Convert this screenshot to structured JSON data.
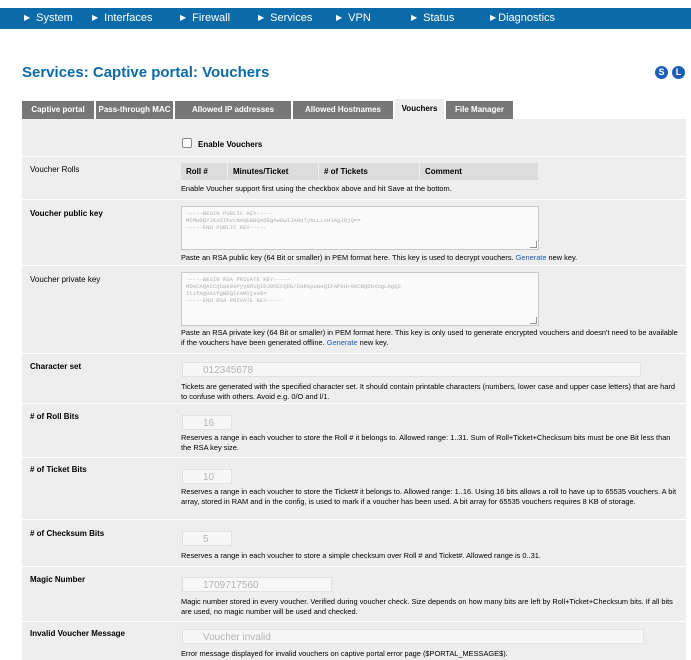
{
  "nav": {
    "items": [
      "System",
      "Interfaces",
      "Firewall",
      "Services",
      "VPN",
      "Status",
      "Diagnostics"
    ]
  },
  "page": {
    "title": "Services: Captive portal: Vouchers",
    "icon_s": "S",
    "icon_l": "L"
  },
  "tabs": [
    "Captive portal",
    "Pass-through MAC",
    "Allowed IP addresses",
    "Allowed Hostnames",
    "Vouchers",
    "File Manager"
  ],
  "active_tab": "Vouchers",
  "enable": {
    "label": "Enable Vouchers",
    "checked": false
  },
  "rolls": {
    "label": "Voucher Rolls",
    "columns": [
      "Roll #",
      "Minutes/Ticket",
      "# of Tickets",
      "Comment"
    ],
    "note": "Enable Voucher support first using the checkbox above and hit Save at the bottom."
  },
  "public_key": {
    "label": "Voucher public key",
    "value": "-----BEGIN PUBLIC KEY-----\nMCMwDQYJKoZIhvcNAQEBBQADEgAwDwIJANqTybLLLxH1AgJ8jQ==\n-----END PUBLIC KEY-----",
    "desc_before": "Paste an RSA public key (64 Bit or smaller) in PEM format here. This key is used to decrypt vouchers.",
    "link": "Generate",
    "desc_after": "new key."
  },
  "private_key": {
    "label": "Voucher private key",
    "value": "-----BEGIN RSA PRIVATE KEY-----\nMDsCAQACCQDak8sPyy8RSQIDJ0OCCQDG/DaRspuGeQIFAP8U+00CBQDbXUgLAgQ2\nItzfAgUAifgWEQIFAM3jse8=\n-----END RSA PRIVATE KEY-----",
    "desc_before": "Paste an RSA private key (64 Bit or smaller) in PEM format here. This key is only used to generate encrypted vouchers and doesn't need to be available if the vouchers have been generated offline.",
    "link": "Generate",
    "desc_after": "new key."
  },
  "charset": {
    "label": "Character set",
    "value": "012345678",
    "desc": "Tickets are generated with the specified character set. It should contain printable characters (numbers, lower case and upper case letters) that are hard to confuse with others. Avoid e.g. 0/O and l/1."
  },
  "roll_bits": {
    "label": "# of Roll Bits",
    "value": "16",
    "desc": "Reserves a range in each voucher to store the Roll # it belongs to. Allowed range: 1..31. Sum of Roll+Ticket+Checksum bits must be one Bit less than the RSA key size."
  },
  "ticket_bits": {
    "label": "# of Ticket Bits",
    "value": "10",
    "desc": "Reserves a range in each voucher to store the Ticket# it belongs to. Allowed range: 1..16. Using 16 bits allows a roll to have up to 65535 vouchers. A bit array, stored in RAM and in the config, is used to mark if a voucher has been used. A bit array for 65535 vouchers requires 8 KB of storage."
  },
  "checksum_bits": {
    "label": "# of Checksum Bits",
    "value": "5",
    "desc": "Reserves a range in each voucher to store a simple checksum over Roll # and Ticket#. Allowed range is 0..31."
  },
  "magic": {
    "label": "Magic Number",
    "value": "1709717560",
    "desc": "Magic number stored in every voucher. Verified during voucher check. Size depends on how many bits are left by Roll+Ticket+Checksum bits. If all bits are used, no magic number will be used and checked."
  },
  "invalid_msg": {
    "label": "Invalid Voucher Message",
    "value": "Voucher invalid",
    "desc": "Error message displayed for invalid vouchers on captive portal error page ($PORTAL_MESSAGE$)."
  },
  "colors": {
    "nav": "#0b6ba8",
    "title": "#0b6ba8",
    "tab": "#777777",
    "panel": "#eeeeee",
    "link": "#1c5eb5"
  }
}
